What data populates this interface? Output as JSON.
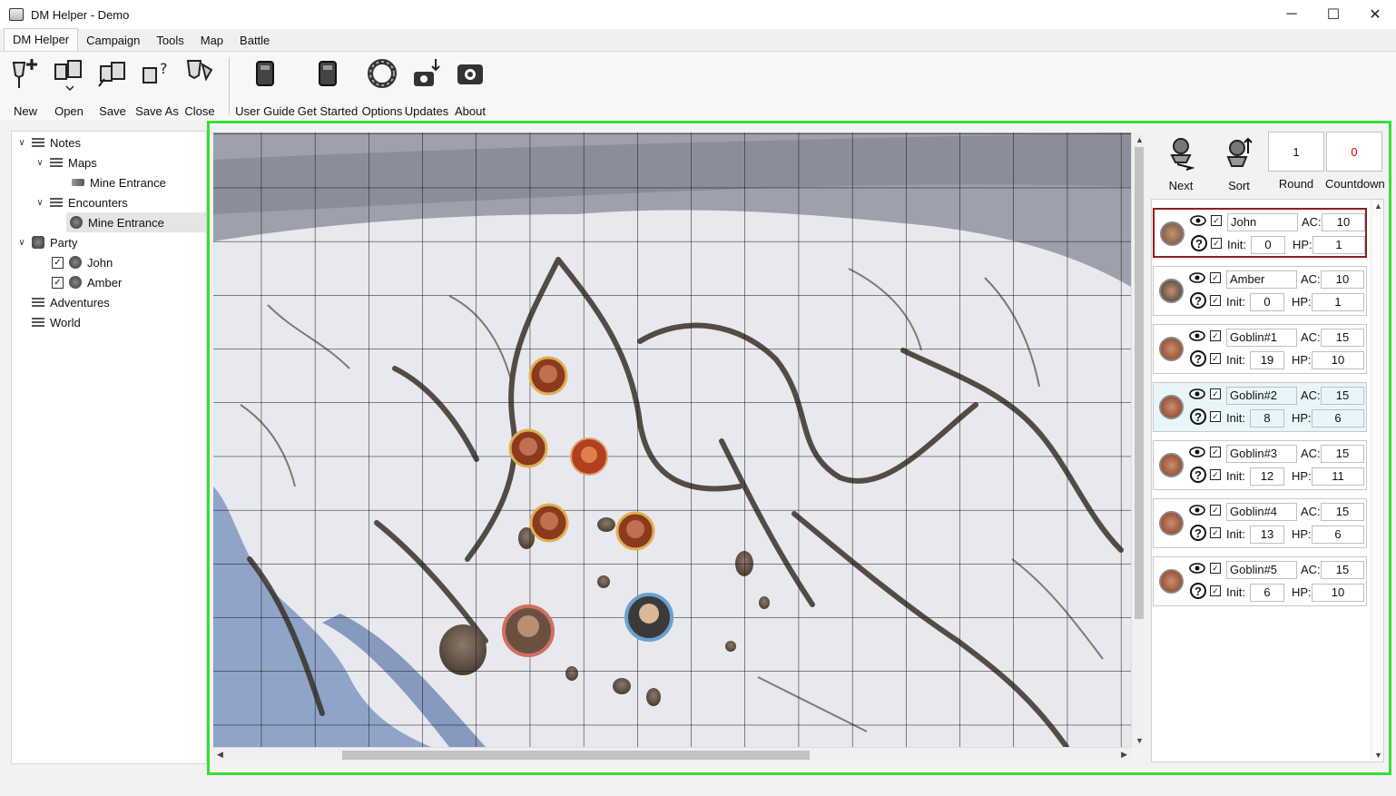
{
  "window": {
    "title": "DM Helper - Demo",
    "minimize": "─",
    "maximize": "☐",
    "close": "✕"
  },
  "menu_tabs": [
    "DM Helper",
    "Campaign",
    "Tools",
    "Map",
    "Battle"
  ],
  "ribbon": {
    "new": "New",
    "open": "Open",
    "save": "Save",
    "save_as": "Save As",
    "close": "Close",
    "user_guide": "User Guide",
    "get_started": "Get Started",
    "options": "Options",
    "updates": "Updates",
    "about": "About"
  },
  "tree": {
    "notes": "Notes",
    "maps": "Maps",
    "map_mine": "Mine Entrance",
    "encounters": "Encounters",
    "enc_mine": "Mine Entrance",
    "party": "Party",
    "john": "John",
    "amber": "Amber",
    "adventures": "Adventures",
    "world": "World"
  },
  "combat": {
    "next": "Next",
    "sort": "Sort",
    "round_value": "1",
    "round_label": "Round",
    "countdown_value": "0",
    "countdown_label": "Countdown",
    "ac_label": "AC:",
    "init_label": "Init:",
    "hp_label": "HP:"
  },
  "combatants": [
    {
      "name": "John",
      "ac": "10",
      "init": "0",
      "hp": "1"
    },
    {
      "name": "Amber",
      "ac": "10",
      "init": "0",
      "hp": "1"
    },
    {
      "name": "Goblin#1",
      "ac": "15",
      "init": "19",
      "hp": "10"
    },
    {
      "name": "Goblin#2",
      "ac": "15",
      "init": "8",
      "hp": "6"
    },
    {
      "name": "Goblin#3",
      "ac": "15",
      "init": "12",
      "hp": "11"
    },
    {
      "name": "Goblin#4",
      "ac": "15",
      "init": "13",
      "hp": "6"
    },
    {
      "name": "Goblin#5",
      "ac": "15",
      "init": "6",
      "hp": "10"
    }
  ],
  "colors": {
    "highlight_frame": "#35e035",
    "countdown": "#cc0000",
    "selected_border": "#8b1f1f",
    "active_row": "#e8f6fa"
  }
}
